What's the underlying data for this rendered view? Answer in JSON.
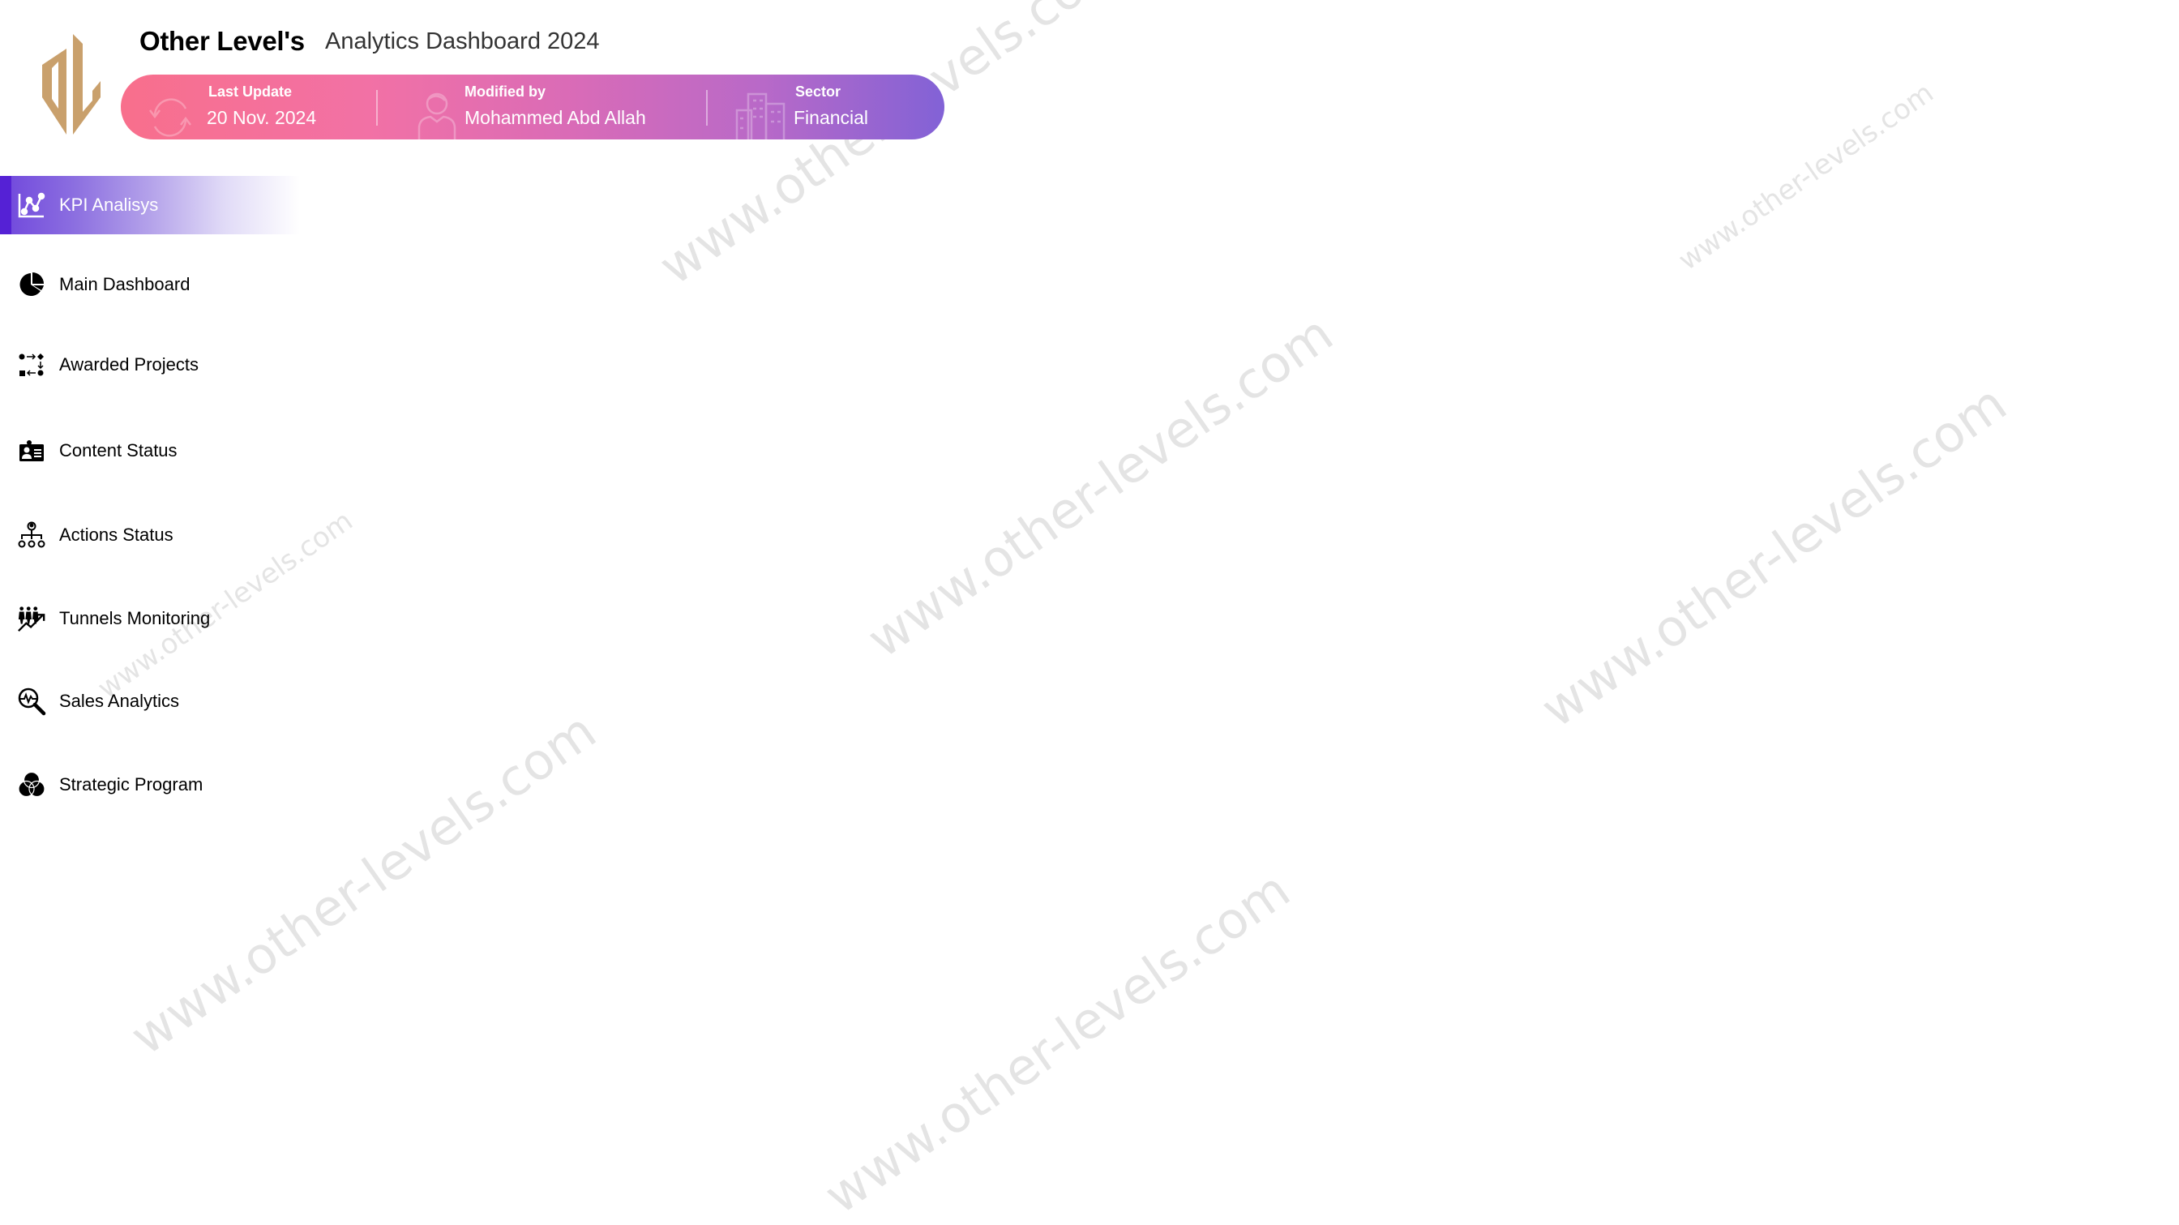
{
  "header": {
    "brand": "Other Level's",
    "subtitle": "Analytics Dashboard 2024",
    "logo_icon": "other-levels-logo",
    "brand_color": "#c9a06c"
  },
  "info_bar": {
    "gradient": [
      "#f86f8c",
      "#f271a5",
      "#d96bb7",
      "#b869c8",
      "#8262d6"
    ],
    "sections": [
      {
        "icon": "refresh-icon",
        "label": "Last Update",
        "value": "20 Nov. 2024"
      },
      {
        "icon": "user-icon",
        "label": "Modified by",
        "value": "Mohammed Abd Allah"
      },
      {
        "icon": "buildings-icon",
        "label": "Sector",
        "value": "Financial"
      }
    ]
  },
  "sidebar": {
    "active_color": "#5521d5",
    "items": [
      {
        "label": "KPI Analisys",
        "icon": "line-chart-icon",
        "active": true
      },
      {
        "label": "Main Dashboard",
        "icon": "pie-chart-icon",
        "active": false
      },
      {
        "label": "Awarded Projects",
        "icon": "workflow-icon",
        "active": false
      },
      {
        "label": "Content Status",
        "icon": "id-card-icon",
        "active": false
      },
      {
        "label": "Actions Status",
        "icon": "org-chart-icon",
        "active": false
      },
      {
        "label": "Tunnels Monitoring",
        "icon": "people-growth-icon",
        "active": false
      },
      {
        "label": "Sales Analytics",
        "icon": "magnify-pulse-icon",
        "active": false
      },
      {
        "label": "Strategic Program",
        "icon": "venn-icon",
        "active": false
      }
    ]
  },
  "watermark": {
    "text": "www.other-levels.com"
  }
}
